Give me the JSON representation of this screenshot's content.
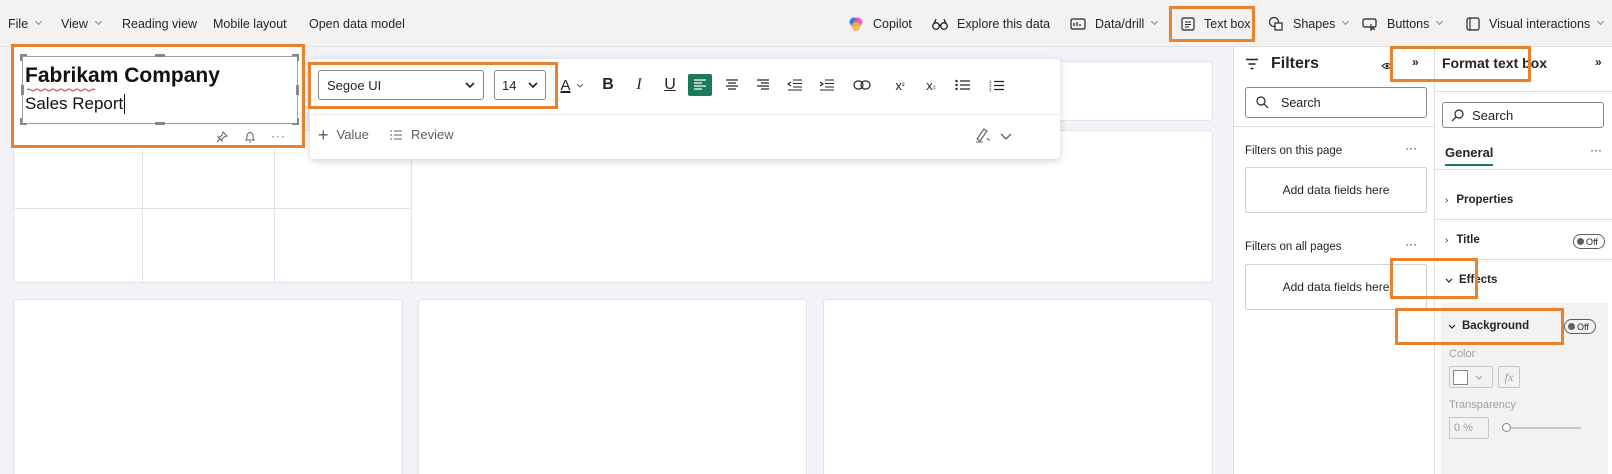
{
  "menu": {
    "file": "File",
    "view": "View",
    "reading_view": "Reading view",
    "mobile_layout": "Mobile layout",
    "open_data_model": "Open data model",
    "copilot": "Copilot",
    "explore": "Explore this data",
    "data_drill": "Data/drill",
    "text_box": "Text box",
    "shapes": "Shapes",
    "buttons": "Buttons",
    "visual_interactions": "Visual interactions"
  },
  "textbox": {
    "title": "Fabrikam Company",
    "subtitle": "Sales Report"
  },
  "format_toolbar": {
    "font": "Segoe UI",
    "size": "14",
    "value": "Value",
    "review": "Review",
    "font_options": [
      "Segoe UI"
    ],
    "size_options": [
      "14"
    ]
  },
  "filters": {
    "title": "Filters",
    "search_placeholder": "Search",
    "on_this_page": "Filters on this page",
    "on_all_pages": "Filters on all pages",
    "add_fields": "Add data fields here",
    "more": "···"
  },
  "format_pane": {
    "title": "Format text box",
    "search_placeholder": "Search",
    "general": "General",
    "more": "···",
    "properties": "Properties",
    "title_section": "Title",
    "title_toggle": "Off",
    "effects": "Effects",
    "background": "Background",
    "background_toggle": "Off",
    "color_label": "Color",
    "transparency_label": "Transparency",
    "transparency_value": "0 %"
  },
  "colors": {
    "accent_highlight": "#e8822e",
    "align_active": "#1b7a5c",
    "canvas_bg": "#f2f2f8"
  }
}
